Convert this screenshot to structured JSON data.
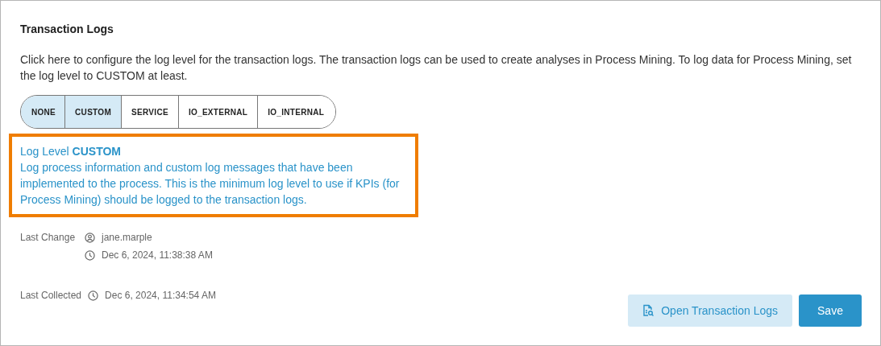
{
  "title": "Transaction Logs",
  "description": "Click here to configure the log level for the transaction logs. The transaction logs can be used to create analyses in Process Mining. To log data for Process Mining, set the log level to CUSTOM at least.",
  "levels": [
    {
      "label": "NONE",
      "selected": true
    },
    {
      "label": "CUSTOM",
      "selected": true
    },
    {
      "label": "SERVICE",
      "selected": false
    },
    {
      "label": "IO_EXTERNAL",
      "selected": false
    },
    {
      "label": "IO_INTERNAL",
      "selected": false
    }
  ],
  "info": {
    "heading": "Log Level **CUSTOM**",
    "text": "Log process information and custom log messages that have been implemented to the process. This is the minimum log level to use if KPIs (for Process Mining) should be logged to the transaction logs."
  },
  "last_change": {
    "label": "Last Change",
    "user": "jane.marple",
    "time": "Dec 6, 2024, 11:38:38 AM"
  },
  "last_collected": {
    "label": "Last Collected",
    "time": "Dec 6, 2024, 11:34:54 AM"
  },
  "buttons": [
    {
      "label": "Open Transaction Logs",
      "kind": "secondary"
    },
    {
      "label": "Save",
      "kind": "primary"
    }
  ]
}
